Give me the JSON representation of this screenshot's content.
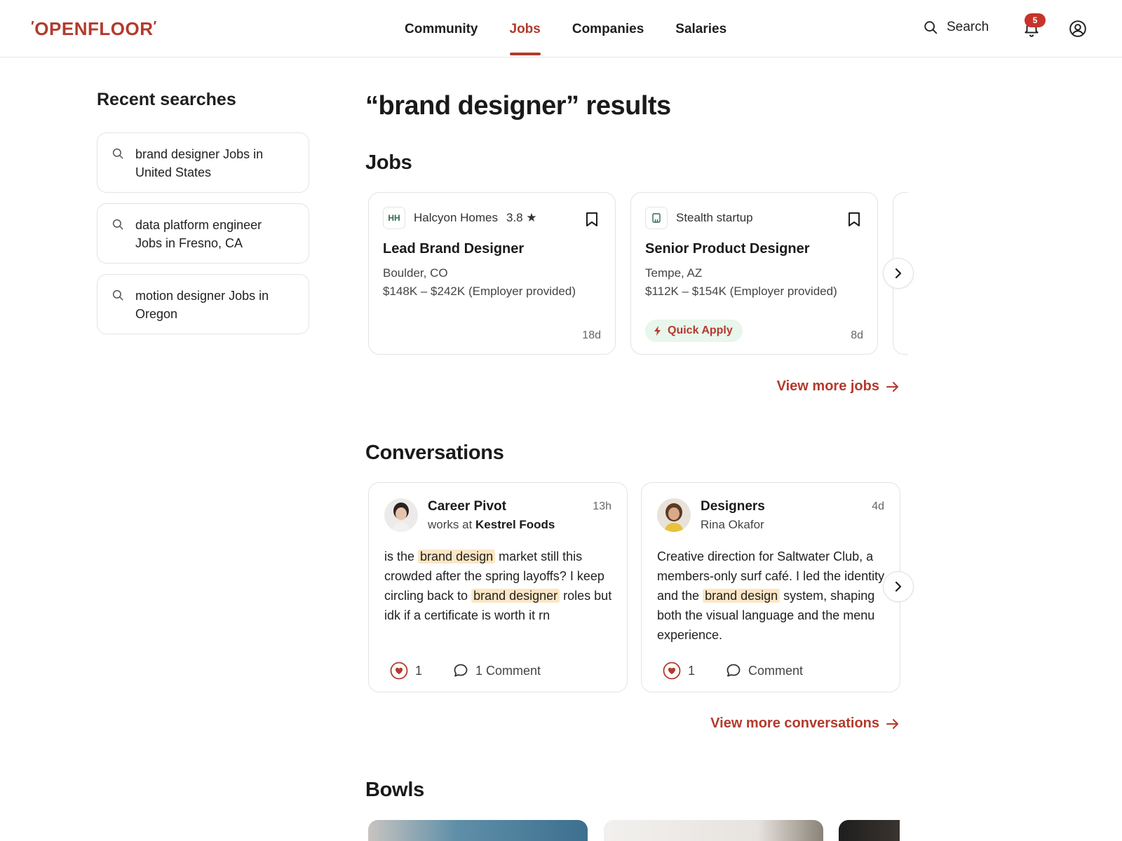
{
  "header": {
    "logo": "OPENFLOOR",
    "nav": [
      "Community",
      "Jobs",
      "Companies",
      "Salaries"
    ],
    "active_nav": "Jobs",
    "search_label": "Search",
    "notification_count": "5"
  },
  "sidebar": {
    "title": "Recent searches",
    "items": [
      {
        "line1": "brand designer Jobs in",
        "line2": "United States"
      },
      {
        "line1": "data platform engineer",
        "line2": "Jobs in Fresno, CA"
      },
      {
        "line1": "motion designer Jobs in",
        "line2": "Oregon"
      }
    ]
  },
  "main": {
    "results_title": "“brand designer” results",
    "jobs_title": "Jobs",
    "jobs": [
      {
        "logo": "HH",
        "company": "Halcyon Homes",
        "rating": "3.8",
        "title": "Lead Brand Designer",
        "location": "Boulder, CO",
        "salary": "$148K – $242K (Employer provided)",
        "age": "18d"
      },
      {
        "company": "Stealth startup",
        "title": "Senior Product Designer",
        "location": "Tempe, AZ",
        "salary": "$112K – $154K (Employer provided)",
        "quick_apply": "Quick Apply",
        "age": "8d"
      }
    ],
    "view_more_jobs": "View more jobs",
    "conversations_title": "Conversations",
    "conversations": [
      {
        "bowl": "Career Pivot",
        "sub_prefix": "works at",
        "sub_company": "Kestrel Foods",
        "age": "13h",
        "body": [
          {
            "t": "is the "
          },
          {
            "t": "brand design",
            "hl": true
          },
          {
            "t": " market still this crowded after the spring layoffs? I keep circling back to "
          },
          {
            "t": "brand designer",
            "hl": true
          },
          {
            "t": " roles but idk if a certificate is worth it rn"
          }
        ],
        "likes": "1",
        "comments": "1 Comment"
      },
      {
        "bowl": "Designers",
        "author": "Rina Okafor",
        "age": "4d",
        "body": [
          {
            "t": "Creative direction for Saltwater Club, a members-only surf café. I led the identity and the "
          },
          {
            "t": "brand design",
            "hl": true
          },
          {
            "t": " system, shaping both the visual language and the menu experience."
          }
        ],
        "likes": "1",
        "comments": "Comment"
      }
    ],
    "view_more_conversations": "View more conversations",
    "bowls_title": "Bowls"
  },
  "colors": {
    "accent": "#b33a2c",
    "highlight": "#fbe6c4",
    "quick_apply_bg": "#e8f6ec"
  }
}
